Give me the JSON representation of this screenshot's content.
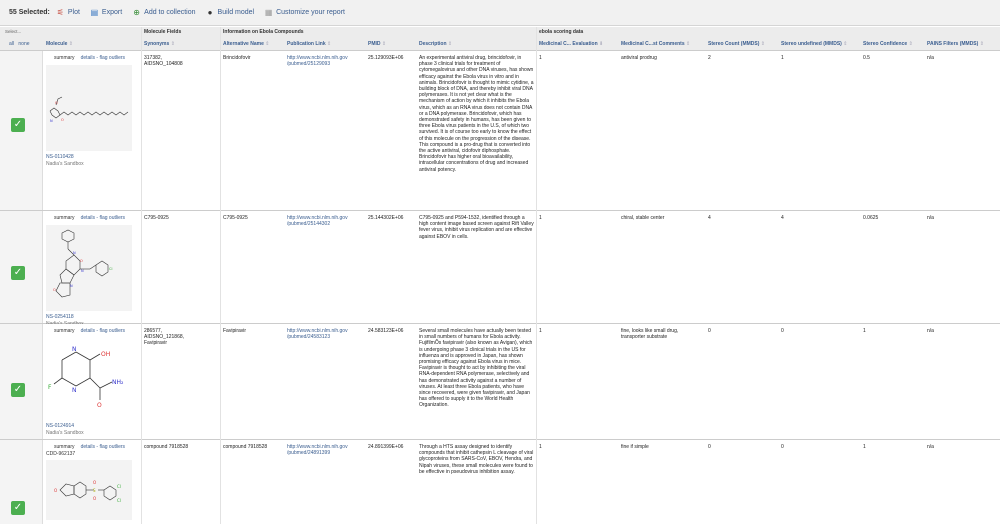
{
  "toolbar": {
    "selected_label": "55 Selected:",
    "plot": "Plot",
    "export": "Export",
    "add_to_collection": "Add to collection",
    "build_model": "Build model",
    "customize_report": "Customize your report"
  },
  "header_groups": {
    "molecule_fields": "Molecule Fields",
    "ebola_info": "Information on Ebola Compounds",
    "ebola_scoring": "ebola scoring data"
  },
  "select_column": {
    "title": "Select...",
    "all": "all",
    "none": "none"
  },
  "columns": {
    "molecule": "Molecule",
    "synonyms": "Synonyms",
    "alt_name": "Alternative Name",
    "pub_link": "Publication Link",
    "pmid": "PMID",
    "description": "Description",
    "med_eval": "Medicinal C... Evaluation",
    "med_comments": "Medicinal C...st Comments",
    "stereo_count": "Stereo Count (MMDS)",
    "stereo_undef": "Stereo undefined (MMDS)",
    "stereo_conf": "Stereo Confidence",
    "pains": "PAINS Filters (MMDS)"
  },
  "sort_arrow": "⇕",
  "sort_desc": "⬇",
  "rows": [
    {
      "summary": "summary",
      "details": "details - flag outliers",
      "cid": "NS-0110428",
      "sandbox": "Nadia's Sandbox",
      "synonyms": "317382,\nAIDSNO_104808",
      "alt_name": "Brincidofovir",
      "pub_link": "http://www.ncbi.nlm.nih.gov\n/pubmed/25129093",
      "pmid": "25.129093E+06",
      "description": "An experimental antiviral drug, brincidofovir, in phase 3 clinical trials for treatment of cytomegalovirus and other DNA viruses, has shown efficacy against the Ebola virus in vitro and in animals. Brincidofovir is thought to mimic cytidine, a building block of DNA, and thereby inhibit viral DNA polymerases. It is not yet clear what is the mechanism of action by which it inhibits the Ebola virus, which as an RNA virus does not contain DNA or a DNA polymerase. Brincidofovir, which has demonstrated safety in humans, has been given to three Ebola virus patients in the U.S, of which two survived. It is of course too early to know the effect of this molecule on the progression of the disease. This compound is a pro-drug that is converted into the active antiviral, cidofovir diphosphate. Brincidofovir has higher oral bioavailability, intracellular concentrations of drug and increased antiviral potency.",
      "med_eval": "1",
      "med_comments": "antiviral prodrug",
      "stereo_count": "2",
      "stereo_undef": "1",
      "stereo_conf": "0.5",
      "pains": "n/a"
    },
    {
      "summary": "summary",
      "details": "details - flag outliers",
      "cid": "NS-0254118",
      "sandbox": "Nadia's Sandbox",
      "synonyms": "C795-0925",
      "alt_name": "C795-0925",
      "pub_link": "http://www.ncbi.nlm.nih.gov\n/pubmed/25144302",
      "pmid": "25.144302E+06",
      "description": "C795-0925 and P594-1532, identified through a high content image based screen against Rift Valley fever virus, inhibit virus replication and are effective against EBOV in cells.",
      "med_eval": "1",
      "med_comments": "chiral, stable center",
      "stereo_count": "4",
      "stereo_undef": "4",
      "stereo_conf": "0.0625",
      "pains": "n/a"
    },
    {
      "summary": "summary",
      "details": "details - flag outliers",
      "cid": "NS-0124914",
      "sandbox": "Nadia's Sandbox",
      "synonyms": "286577,\nAIDSNO_121868,\nFavipiravir",
      "alt_name": "Favipiravir",
      "pub_link": "http://www.ncbi.nlm.nih.gov\n/pubmed/24583123",
      "pmid": "24.583123E+06",
      "description": "Several small molecules have actually been tested in small numbers of humans for Ebola activity. FujifilmÕs favipiravir (also known as Avigan), which is undergoing phase 3 clinical trials in the US for influenza and is approved in Japan, has shown promising efficacy against Ebola virus in mice. Favipiravir is thought to act by inhibiting the viral RNA-dependent RNA polymerase, selectively and has demonstrated activity against a number of viruses. At least three Ebola patients, who have since recovered, were given favipiravir, and Japan has offered to supply it to the World Health Organization.",
      "med_eval": "1",
      "med_comments": "fine, looks like small drug,\ntransporter substrate",
      "stereo_count": "0",
      "stereo_undef": "0",
      "stereo_conf": "1",
      "pains": "n/a"
    },
    {
      "summary": "summary",
      "details": "details - flag outliers",
      "cdd": "CDD-962137",
      "synonyms": "compound 7918528",
      "alt_name": "compound 7918528",
      "pub_link": "http://www.ncbi.nlm.nih.gov\n/pubmed/24891399",
      "pmid": "24.891399E+06",
      "description": "Through a HTS assay designed to identify compounds that inhibit cathepsin L cleavage of viral glycoproteins from SARS-CoV, EBOV, Hendra, and Nipah viruses, these small molecules were found to be effective in pseudovirus inhibition assay.",
      "med_eval": "1",
      "med_comments": "fine if simple",
      "stereo_count": "0",
      "stereo_undef": "0",
      "stereo_conf": "1",
      "pains": "n/a"
    }
  ],
  "atom_labels": {
    "oh": "OH",
    "f": "F",
    "n": "N",
    "o": "O",
    "nh2": "NH₂",
    "cl": "Cl",
    "s": "S"
  }
}
